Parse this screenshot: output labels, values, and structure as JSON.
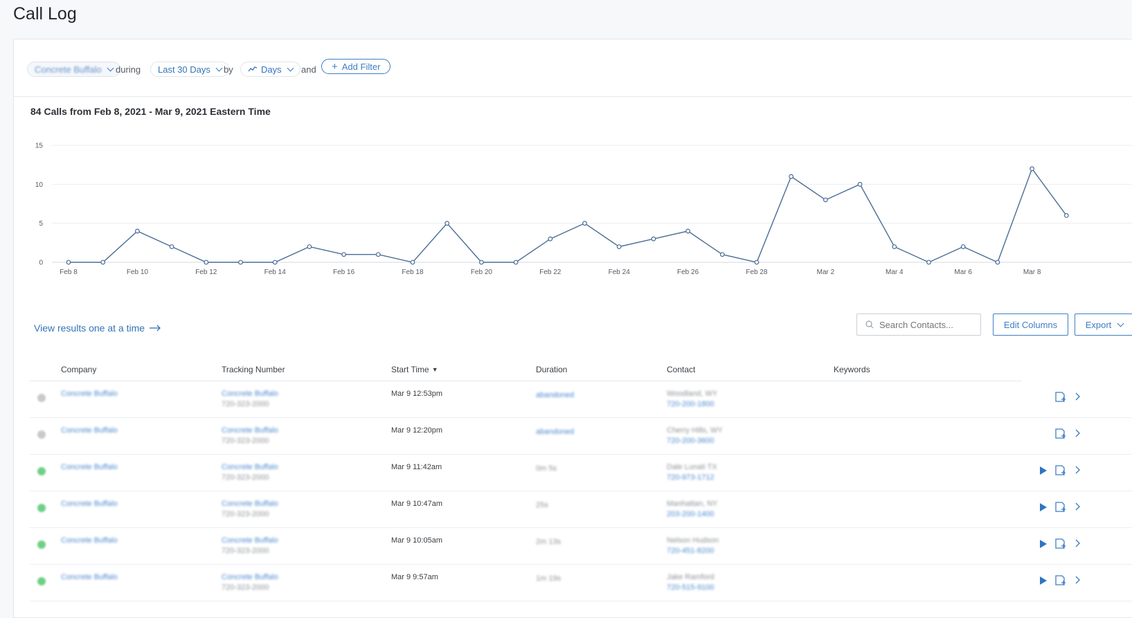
{
  "page_title": "Call Log",
  "filters": {
    "company_value": "Concrete Buffalo",
    "during_label": "during",
    "range_value": "Last 30 Days",
    "by_label": "by",
    "interval_value": "Days",
    "and_label": "and",
    "add_filter_label": "Add Filter"
  },
  "chart_data": {
    "type": "line",
    "title": "84 Calls from Feb 8, 2021 - Mar 9, 2021 Eastern Time",
    "xlabel": "",
    "ylabel": "",
    "x": [
      "Feb 8",
      "Feb 9",
      "Feb 10",
      "Feb 11",
      "Feb 12",
      "Feb 13",
      "Feb 14",
      "Feb 15",
      "Feb 16",
      "Feb 17",
      "Feb 18",
      "Feb 19",
      "Feb 20",
      "Feb 21",
      "Feb 22",
      "Feb 23",
      "Feb 24",
      "Feb 25",
      "Feb 26",
      "Feb 27",
      "Feb 28",
      "Mar 1",
      "Mar 2",
      "Mar 3",
      "Mar 4",
      "Mar 5",
      "Mar 6",
      "Mar 7",
      "Mar 8",
      "Mar 9"
    ],
    "x_tick_labels": [
      "Feb 8",
      "Feb 10",
      "Feb 12",
      "Feb 14",
      "Feb 16",
      "Feb 18",
      "Feb 20",
      "Feb 22",
      "Feb 24",
      "Feb 26",
      "Feb 28",
      "Mar 2",
      "Mar 4",
      "Mar 6",
      "Mar 8"
    ],
    "values": [
      0,
      0,
      4,
      2,
      0,
      0,
      0,
      2,
      1,
      1,
      0,
      5,
      0,
      0,
      3,
      5,
      2,
      3,
      4,
      1,
      0,
      11,
      8,
      10,
      2,
      0,
      2,
      0,
      12,
      6
    ],
    "y_ticks": [
      0,
      5,
      10,
      15
    ],
    "ylim": [
      0,
      15
    ],
    "grid": true,
    "legend": "none",
    "line_color": "#4a6d94"
  },
  "table_controls": {
    "view_link": "View results one at a time",
    "search_placeholder": "Search Contacts...",
    "edit_columns": "Edit Columns",
    "export": "Export"
  },
  "table": {
    "headers": {
      "company": "Company",
      "tracking": "Tracking Number",
      "start": "Start Time",
      "duration": "Duration",
      "contact": "Contact",
      "keywords": "Keywords"
    },
    "rows": [
      {
        "status": "missed",
        "company": "Concrete Buffalo",
        "tracking": "Concrete Buffalo",
        "tracking_num": "720-323-2000",
        "start": "Mar 9 12:53pm",
        "duration": "abandoned",
        "contact": "Woodland, WY",
        "contact_num": "720-200-1800",
        "play": false
      },
      {
        "status": "missed",
        "company": "Concrete Buffalo",
        "tracking": "Concrete Buffalo",
        "tracking_num": "720-323-2000",
        "start": "Mar 9 12:20pm",
        "duration": "abandoned",
        "contact": "Cherry Hills, WY",
        "contact_num": "720-200-3600",
        "play": false
      },
      {
        "status": "answered",
        "company": "Concrete Buffalo",
        "tracking": "Concrete Buffalo",
        "tracking_num": "720-323-2000",
        "start": "Mar 9 11:42am",
        "duration": "0m 5s",
        "contact": "Dale Lunati TX",
        "contact_num": "720-973-1712",
        "play": true
      },
      {
        "status": "answered",
        "company": "Concrete Buffalo",
        "tracking": "Concrete Buffalo",
        "tracking_num": "720-323-2000",
        "start": "Mar 9 10:47am",
        "duration": "25s",
        "contact": "Manhattan, NY",
        "contact_num": "203-200-1400",
        "play": true
      },
      {
        "status": "answered",
        "company": "Concrete Buffalo",
        "tracking": "Concrete Buffalo",
        "tracking_num": "720-323-2000",
        "start": "Mar 9 10:05am",
        "duration": "2m 13s",
        "contact": "Nelson Hudson",
        "contact_num": "720-451-8200",
        "play": true
      },
      {
        "status": "answered",
        "company": "Concrete Buffalo",
        "tracking": "Concrete Buffalo",
        "tracking_num": "720-323-2000",
        "start": "Mar 9 9:57am",
        "duration": "1m 19s",
        "contact": "Jake Ramford",
        "contact_num": "720-515-9100",
        "play": true
      }
    ]
  },
  "colors": {
    "accent": "#3e7fc4",
    "answered": "#6fcf87",
    "missed": "#c7c9cc"
  }
}
